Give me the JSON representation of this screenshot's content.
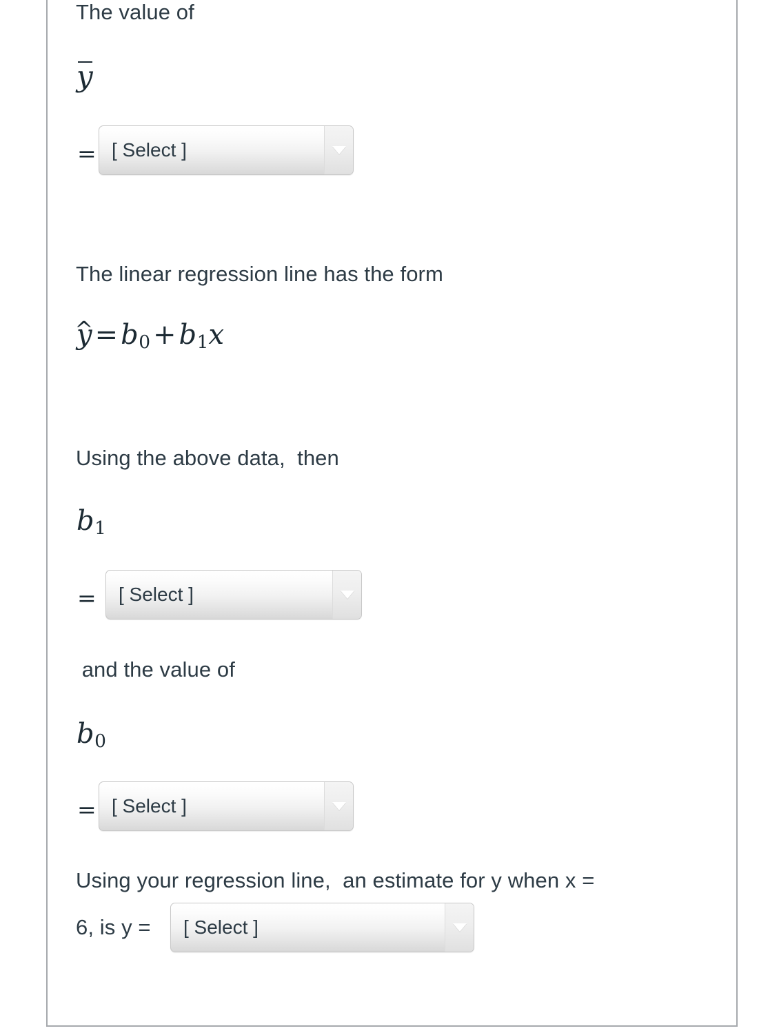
{
  "question": {
    "lines": {
      "value_of": "The value of",
      "linear_form_intro": "The linear regression line has the form",
      "using_above_data": "Using the above data,  then",
      "and_the_value_of": " and the value of",
      "estimate_line_1": "Using your regression line,  an estimate for y when x =",
      "estimate_line_2": "6, is y ="
    },
    "math": {
      "y_bar": {
        "base": "y",
        "accent": "¯",
        "accent_name": "overbar"
      },
      "regression_equation": {
        "lhs_base": "y",
        "lhs_accent": "^",
        "lhs_accent_name": "hat",
        "equals": "=",
        "term1_base": "b",
        "term1_sub": "0",
        "plus": "+",
        "term2_base": "b",
        "term2_sub": "1",
        "term3": "x"
      },
      "b_one": {
        "base": "b",
        "sub": "1"
      },
      "b_zero": {
        "base": "b",
        "sub": "0"
      },
      "equals_sign": "="
    },
    "dropdowns": [
      {
        "id": "y-bar-select",
        "label": "[ Select ]"
      },
      {
        "id": "b1-select",
        "label": "[ Select ]"
      },
      {
        "id": "b0-select",
        "label": "[ Select ]"
      },
      {
        "id": "y-estimate-select",
        "label": "[ Select ]"
      }
    ]
  },
  "colors": {
    "text": "#2d3b45",
    "math": "#1c2a33",
    "frame_border": "#a6a9ad",
    "select_border": "#c7c7c7",
    "page_background": "#ffffff"
  }
}
